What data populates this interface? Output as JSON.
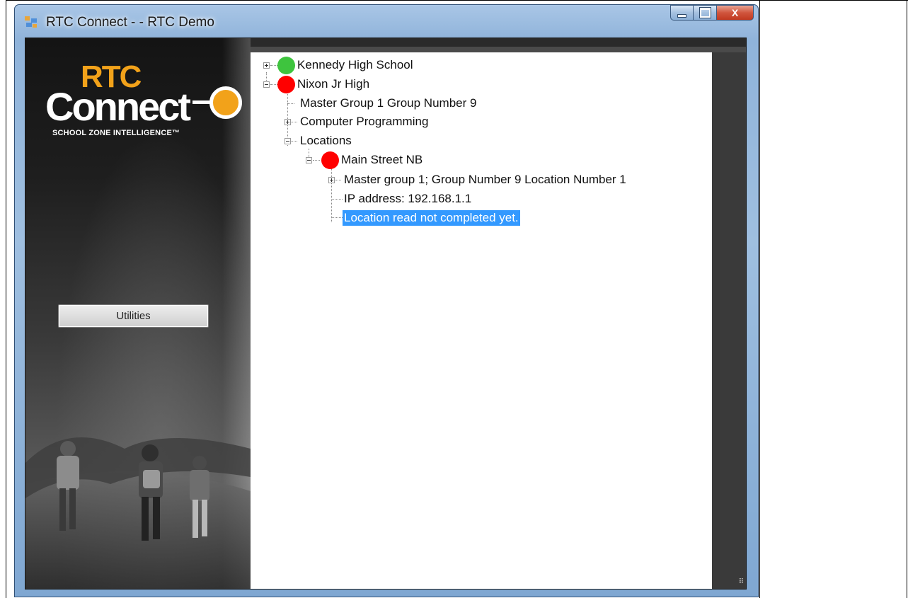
{
  "window": {
    "title": "RTC Connect - -  RTC Demo",
    "caption_buttons": {
      "minimize": "–",
      "maximize": "□",
      "close": "X"
    }
  },
  "branding": {
    "logo_top": "RTC",
    "logo_main": "Connect",
    "tagline": "SCHOOL ZONE INTELLIGENCE™"
  },
  "left_panel": {
    "utilities_label": "Utilities"
  },
  "colors": {
    "status_ok": "#3ec43e",
    "status_error": "#ff0000",
    "selection": "#3399ff"
  },
  "tree": {
    "items": [
      {
        "label": "Kennedy High School",
        "status": "green",
        "expander": "plus"
      },
      {
        "label": "Nixon Jr High",
        "status": "red",
        "expander": "minus"
      },
      {
        "label": "Master Group 1 Group Number 9"
      },
      {
        "label": "Computer Programming",
        "expander": "plus"
      },
      {
        "label": "Locations",
        "expander": "minus"
      },
      {
        "label": "Main Street NB",
        "status": "red",
        "expander": "minus"
      },
      {
        "label": "Master group 1; Group Number 9 Location Number 1",
        "expander": "plus"
      },
      {
        "label": "IP address: 192.168.1.1"
      },
      {
        "label": "Location read not completed yet.",
        "selected": true
      }
    ]
  }
}
